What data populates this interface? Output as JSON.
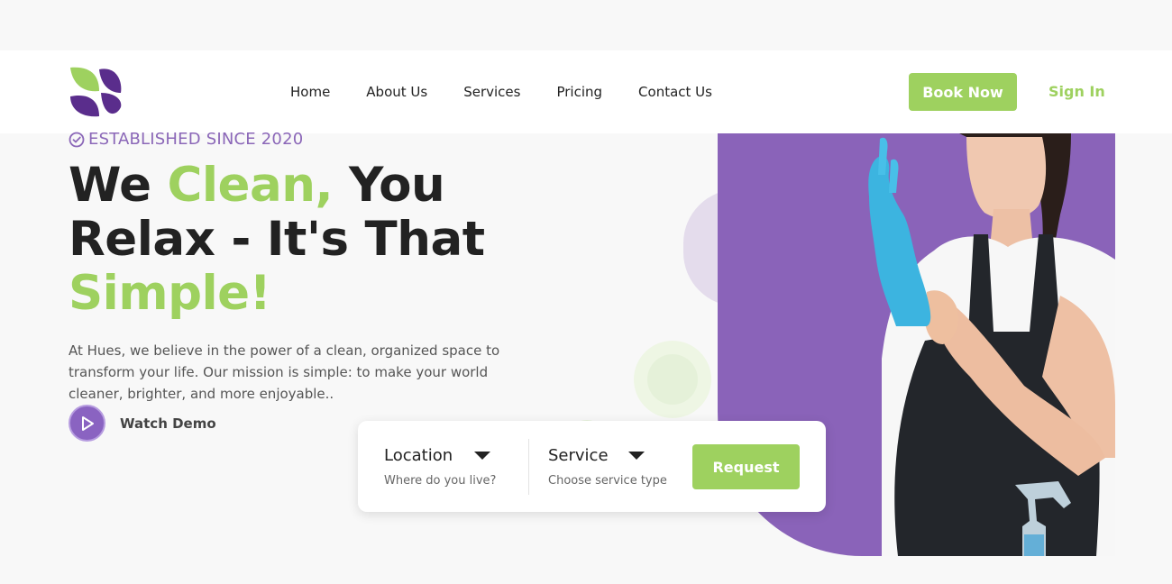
{
  "brand": {
    "logo_icon": "leaf-logo-icon",
    "primary_color": "#8a63b9",
    "accent_color": "#9ed15f"
  },
  "nav": {
    "items": [
      {
        "label": "Home"
      },
      {
        "label": "About Us"
      },
      {
        "label": "Services"
      },
      {
        "label": "Pricing"
      },
      {
        "label": "Contact Us"
      }
    ],
    "book_label": "Book Now",
    "signin_label": "Sign In"
  },
  "hero": {
    "established": "ESTABLISHED SINCE 2020",
    "headline": {
      "part1": "We ",
      "highlight1": "Clean,",
      "part2": " You Relax - It's That ",
      "highlight2": "Simple!"
    },
    "intro": "At Hues, we believe in the power of a clean, organized space to transform your life. Our mission is simple: to make your world cleaner, brighter, and more enjoyable..",
    "demo_label": "Watch Demo"
  },
  "request_form": {
    "location": {
      "label": "Location",
      "hint": "Where do you live?"
    },
    "service": {
      "label": "Service",
      "hint": "Choose service type"
    },
    "button_label": "Request"
  }
}
